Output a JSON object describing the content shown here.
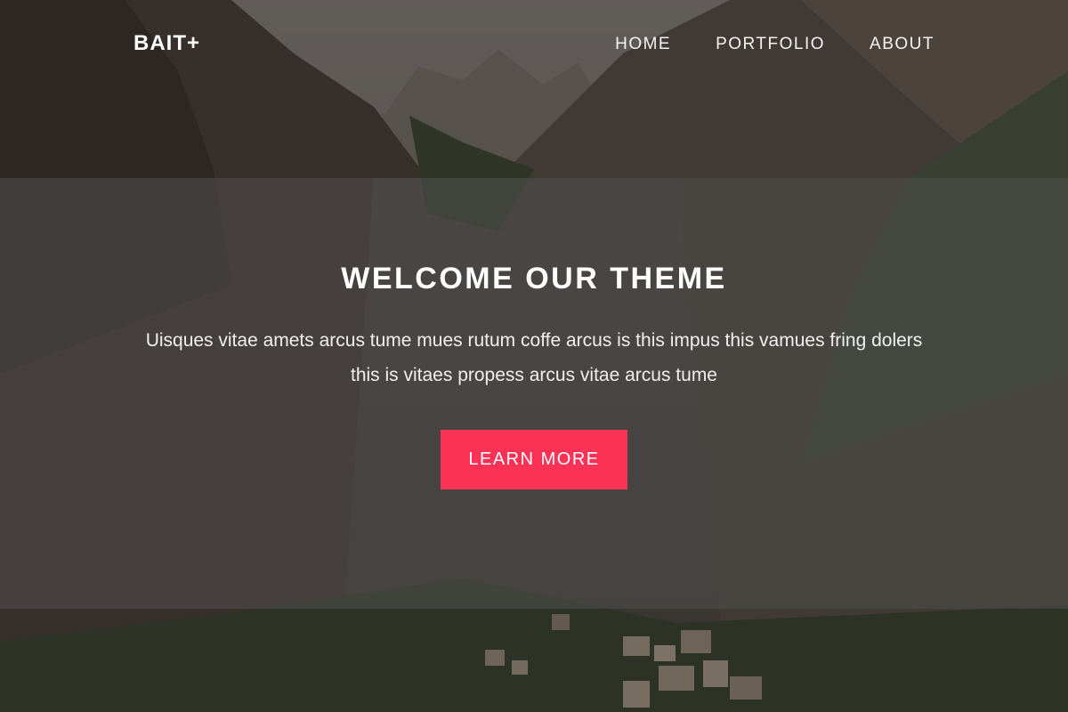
{
  "nav": {
    "brand": "BAIT+",
    "links": [
      "HOME",
      "PORTFOLIO",
      "ABOUT"
    ]
  },
  "hero": {
    "title": "WELCOME OUR THEME",
    "text": "Uisques vitae amets arcus tume mues rutum coffe arcus is this impus this vamues fring dolers this is vitaes propess arcus vitae arcus tume",
    "button_label": "LEARN MORE"
  },
  "colors": {
    "accent": "#fb3155",
    "band_overlay": "#4e4c4a",
    "text": "#ffffff"
  },
  "background": {
    "image": "mountain-valley-photo"
  }
}
